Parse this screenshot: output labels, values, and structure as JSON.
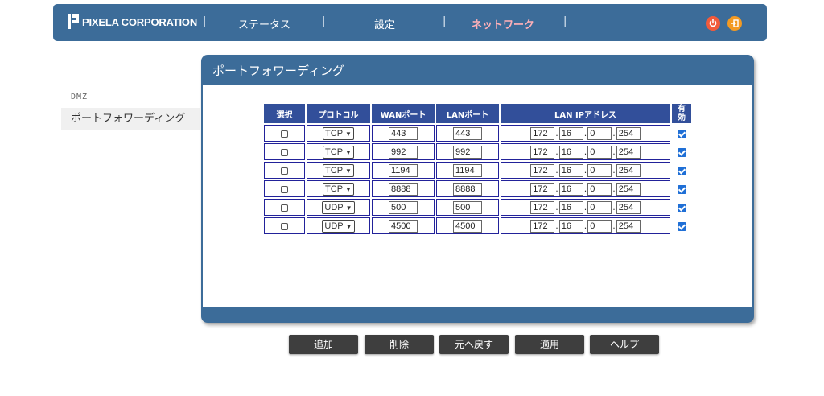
{
  "header": {
    "logo_text": "PIXELA CORPORATION",
    "nav": [
      "ステータス",
      "設定",
      "ネットワーク"
    ],
    "separator": "|",
    "active_index": 2,
    "colors": {
      "bar": "#3c6c99",
      "active": "#ffb0b8",
      "power": "#f25a3b",
      "exit": "#f39a22"
    },
    "icons": [
      "power-icon",
      "exit-icon"
    ]
  },
  "sidebar": {
    "items": [
      {
        "label": "DMZ"
      },
      {
        "label": "ポートフォワーディング"
      }
    ]
  },
  "panel": {
    "title": "ポートフォワーディング"
  },
  "table": {
    "headers": {
      "select": "選択",
      "protocol": "プロトコル",
      "wan_port": "WANポート",
      "lan_port": "LANポート",
      "lan_ip": "LAN IPアドレス",
      "enabled": "有効"
    },
    "rows": [
      {
        "selected": false,
        "protocol": "TCP",
        "wan": "443",
        "lan": "443",
        "ip": [
          "172",
          "16",
          "0",
          "254"
        ],
        "enabled": true
      },
      {
        "selected": false,
        "protocol": "TCP",
        "wan": "992",
        "lan": "992",
        "ip": [
          "172",
          "16",
          "0",
          "254"
        ],
        "enabled": true
      },
      {
        "selected": false,
        "protocol": "TCP",
        "wan": "1194",
        "lan": "1194",
        "ip": [
          "172",
          "16",
          "0",
          "254"
        ],
        "enabled": true
      },
      {
        "selected": false,
        "protocol": "TCP",
        "wan": "8888",
        "lan": "8888",
        "ip": [
          "172",
          "16",
          "0",
          "254"
        ],
        "enabled": true
      },
      {
        "selected": false,
        "protocol": "UDP",
        "wan": "500",
        "lan": "500",
        "ip": [
          "172",
          "16",
          "0",
          "254"
        ],
        "enabled": true
      },
      {
        "selected": false,
        "protocol": "UDP",
        "wan": "4500",
        "lan": "4500",
        "ip": [
          "172",
          "16",
          "0",
          "254"
        ],
        "enabled": true
      }
    ]
  },
  "buttons": {
    "add": "追加",
    "delete": "削除",
    "revert": "元へ戻す",
    "apply": "適用",
    "help": "ヘルプ"
  }
}
